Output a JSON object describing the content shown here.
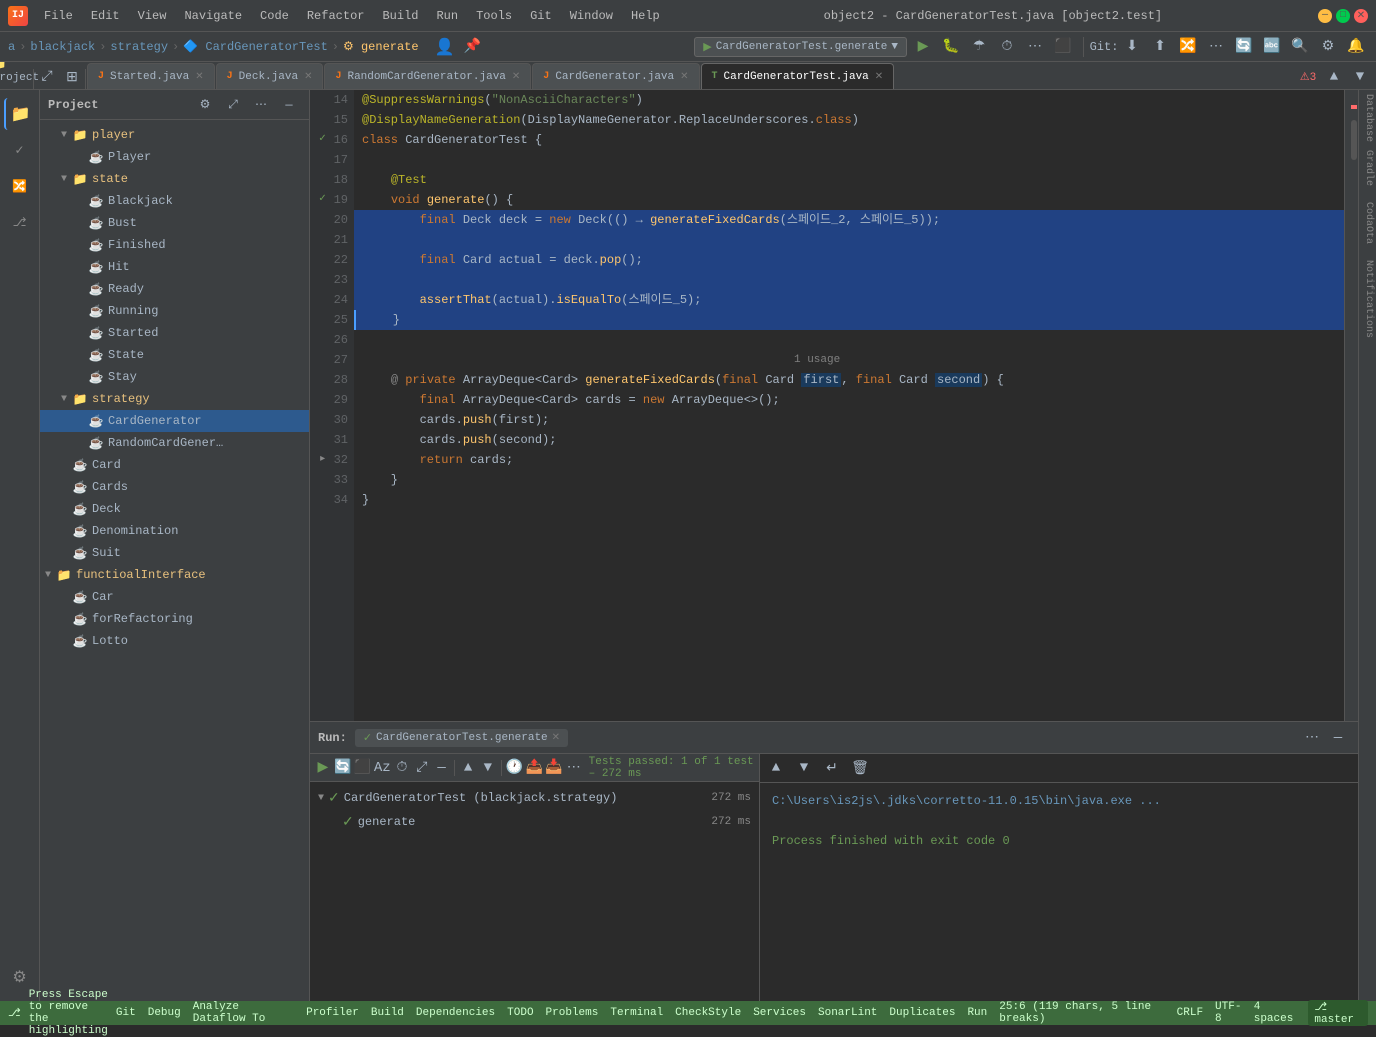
{
  "window": {
    "title": "object2 - CardGeneratorTest.java [object2.test]",
    "logo": "IJ"
  },
  "menu": {
    "items": [
      "File",
      "Edit",
      "View",
      "Navigate",
      "Code",
      "Refactor",
      "Build",
      "Run",
      "Tools",
      "Git",
      "Window",
      "Help"
    ]
  },
  "breadcrumb": {
    "parts": [
      "a",
      "blackjack",
      "strategy",
      "CardGeneratorTest",
      "generate"
    ],
    "icons": [
      "🏠",
      "",
      "",
      "",
      "⚙"
    ]
  },
  "run_config": {
    "label": "CardGeneratorTest.generate",
    "dropdown": "▼"
  },
  "tabs": [
    {
      "label": "Started.java",
      "icon": "J",
      "active": false,
      "modified": false
    },
    {
      "label": "Deck.java",
      "icon": "J",
      "active": false,
      "modified": false
    },
    {
      "label": "RandomCardGenerator.java",
      "icon": "J",
      "active": false,
      "modified": false
    },
    {
      "label": "CardGenerator.java",
      "icon": "J",
      "active": false,
      "modified": false
    },
    {
      "label": "CardGeneratorTest.java",
      "icon": "T",
      "active": true,
      "modified": false
    }
  ],
  "sidebar": {
    "title": "Project",
    "tree": [
      {
        "indent": 1,
        "arrow": "▼",
        "icon": "📁",
        "label": "player",
        "type": "folder"
      },
      {
        "indent": 2,
        "arrow": " ",
        "icon": "☕",
        "label": "Player",
        "type": "java"
      },
      {
        "indent": 1,
        "arrow": "▼",
        "icon": "📁",
        "label": "state",
        "type": "folder"
      },
      {
        "indent": 2,
        "arrow": " ",
        "icon": "☕",
        "label": "Blackjack",
        "type": "java"
      },
      {
        "indent": 2,
        "arrow": " ",
        "icon": "☕",
        "label": "Bust",
        "type": "java"
      },
      {
        "indent": 2,
        "arrow": " ",
        "icon": "☕",
        "label": "Finished",
        "type": "java"
      },
      {
        "indent": 2,
        "arrow": " ",
        "icon": "☕",
        "label": "Hit",
        "type": "java"
      },
      {
        "indent": 2,
        "arrow": " ",
        "icon": "☕",
        "label": "Ready",
        "type": "java"
      },
      {
        "indent": 2,
        "arrow": " ",
        "icon": "☕",
        "label": "Running",
        "type": "java"
      },
      {
        "indent": 2,
        "arrow": " ",
        "icon": "☕",
        "label": "Started",
        "type": "java"
      },
      {
        "indent": 2,
        "arrow": " ",
        "icon": "☕",
        "label": "State",
        "type": "java"
      },
      {
        "indent": 2,
        "arrow": " ",
        "icon": "☕",
        "label": "Stay",
        "type": "java"
      },
      {
        "indent": 1,
        "arrow": "▼",
        "icon": "📁",
        "label": "strategy",
        "type": "folder"
      },
      {
        "indent": 2,
        "arrow": " ",
        "icon": "☕",
        "label": "CardGenerator",
        "type": "java",
        "selected": true
      },
      {
        "indent": 2,
        "arrow": " ",
        "icon": "☕",
        "label": "RandomCardGener…",
        "type": "java"
      },
      {
        "indent": 1,
        "arrow": " ",
        "icon": "☕",
        "label": "Card",
        "type": "java"
      },
      {
        "indent": 1,
        "arrow": " ",
        "icon": "☕",
        "label": "Cards",
        "type": "java"
      },
      {
        "indent": 1,
        "arrow": " ",
        "icon": "☕",
        "label": "Deck",
        "type": "java"
      },
      {
        "indent": 1,
        "arrow": " ",
        "icon": "☕",
        "label": "Denomination",
        "type": "java"
      },
      {
        "indent": 1,
        "arrow": " ",
        "icon": "☕",
        "label": "Suit",
        "type": "java"
      },
      {
        "indent": 0,
        "arrow": "▼",
        "icon": "📁",
        "label": "functioalInterface",
        "type": "folder"
      },
      {
        "indent": 1,
        "arrow": " ",
        "icon": "☕",
        "label": "Car",
        "type": "java"
      },
      {
        "indent": 1,
        "arrow": " ",
        "icon": "☕",
        "label": "forRefactoring",
        "type": "java"
      },
      {
        "indent": 1,
        "arrow": " ",
        "icon": "☕",
        "label": "Lotto",
        "type": "java"
      }
    ]
  },
  "code": {
    "lines": [
      {
        "num": 14,
        "content": "@SuppressWarnings(\"NonAsciiCharacters\")",
        "gutter": ""
      },
      {
        "num": 15,
        "content": "@DisplayNameGeneration(DisplayNameGenerator.ReplaceUnderscores.class)",
        "gutter": ""
      },
      {
        "num": 16,
        "content": "class CardGeneratorTest {",
        "gutter": "✓"
      },
      {
        "num": 17,
        "content": "",
        "gutter": ""
      },
      {
        "num": 18,
        "content": "    @Test",
        "gutter": ""
      },
      {
        "num": 19,
        "content": "    void generate() {",
        "gutter": "✓▸"
      },
      {
        "num": 20,
        "content": "        final Deck deck = new Deck(() → generateFixedCards(스페이드_2, 스페이드_5));",
        "gutter": "",
        "highlight": true
      },
      {
        "num": 21,
        "content": "",
        "gutter": "",
        "highlight": true
      },
      {
        "num": 22,
        "content": "        final Card actual = deck.pop();",
        "gutter": "",
        "highlight": true
      },
      {
        "num": 23,
        "content": "",
        "gutter": "",
        "highlight": true
      },
      {
        "num": 24,
        "content": "        assertThat(actual).isEqualTo(스페이드_5);",
        "gutter": "",
        "highlight": true
      },
      {
        "num": 25,
        "content": "    }",
        "gutter": "",
        "highlight": true,
        "cursor": true
      },
      {
        "num": 26,
        "content": "",
        "gutter": ""
      },
      {
        "num": 27,
        "content": "    @ private ArrayDeque<Card> generateFixedCards(final Card first, final Card second) {",
        "gutter": ""
      },
      {
        "num": 28,
        "content": "        final ArrayDeque<Card> cards = new ArrayDeque<>();",
        "gutter": ""
      },
      {
        "num": 29,
        "content": "        cards.push(first);",
        "gutter": ""
      },
      {
        "num": 30,
        "content": "        cards.push(second);",
        "gutter": ""
      },
      {
        "num": 31,
        "content": "        return cards;",
        "gutter": ""
      },
      {
        "num": 32,
        "content": "    }",
        "gutter": "▸"
      },
      {
        "num": 33,
        "content": "}",
        "gutter": ""
      },
      {
        "num": 34,
        "content": "",
        "gutter": ""
      }
    ],
    "usage_hint": "1 usage"
  },
  "bottom_panel": {
    "run_label": "Run:",
    "tab_name": "CardGeneratorTest.generate",
    "test_status": "Tests passed: 1 of 1 test – 272 ms",
    "test_items": [
      {
        "label": "CardGeneratorTest (blackjack.strategy)",
        "time": "272 ms",
        "status": "pass",
        "expanded": true
      },
      {
        "label": "generate",
        "time": "272 ms",
        "status": "pass",
        "indent": true
      }
    ],
    "output_lines": [
      {
        "text": "C:\\Users\\is2js\\.jdks\\corretto-11.0.15\\bin\\java.exe ...",
        "type": "path"
      },
      {
        "text": "",
        "type": "normal"
      },
      {
        "text": "Process finished with exit code 0",
        "type": "success"
      }
    ]
  },
  "status_bar": {
    "escape_hint": "Press Escape to remove the highlighting",
    "position": "25:6 (119 chars, 5 line breaks)",
    "encoding": "CRLF",
    "charset": "UTF-8",
    "indent": "4 spaces",
    "branch": "master",
    "bottom_tabs": [
      "Git",
      "Debug",
      "Analyze Dataflow To",
      "Profiler",
      "Build",
      "Dependencies",
      "TODO",
      "Problems",
      "Terminal",
      "CheckStyle",
      "Services",
      "SonarLint",
      "Duplicates",
      "Run"
    ]
  },
  "right_tabs": [
    "Database",
    "Gradle",
    "CodaOta",
    "Notifications"
  ],
  "activity_icons": [
    "📁",
    "🔍",
    "🔀",
    "📌",
    "🔧",
    "⚙",
    "👤"
  ]
}
